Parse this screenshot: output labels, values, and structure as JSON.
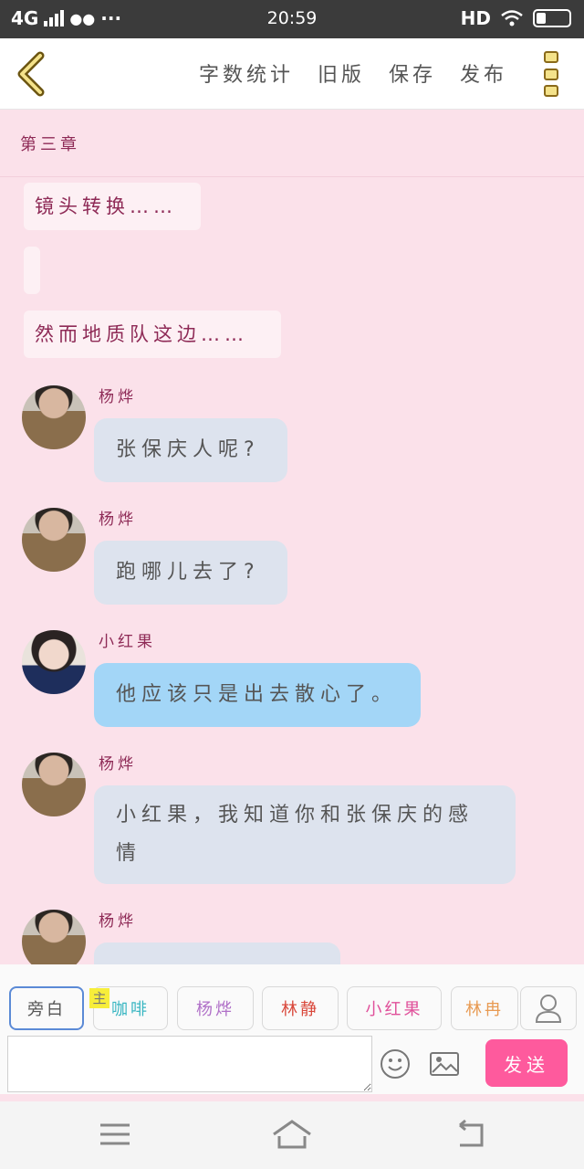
{
  "status_bar": {
    "network": "4G",
    "time": "20:59",
    "hd": "HD"
  },
  "toolbar": {
    "actions": [
      "字数统计",
      "旧版",
      "保存",
      "发布"
    ]
  },
  "chapter": {
    "title": "第三章"
  },
  "narration": [
    "镜头转换……",
    "",
    "然而地质队这边……"
  ],
  "messages": [
    {
      "name": "杨烨",
      "text": "张保庆人呢?",
      "style": "gray"
    },
    {
      "name": "杨烨",
      "text": "跑哪儿去了?",
      "style": "gray"
    },
    {
      "name": "小红果",
      "text": "他应该只是出去散心了。",
      "style": "blue"
    },
    {
      "name": "杨烨",
      "text_line1": "小红果，我知道你和张保庆的感",
      "text_line2": "情",
      "style": "gray"
    },
    {
      "name": "杨烨",
      "text": "",
      "style": "gray"
    }
  ],
  "characters": [
    {
      "label": "旁白",
      "color": "#555555"
    },
    {
      "label": "咖啡",
      "color": "#39b6c2"
    },
    {
      "label": "杨烨",
      "color": "#b070c8"
    },
    {
      "label": "林静",
      "color": "#d9473a"
    },
    {
      "label": "小红果",
      "color": "#e0509a"
    },
    {
      "label": "林冉",
      "color": "#e89a52"
    }
  ],
  "main_badge": "主",
  "input": {
    "placeholder": ""
  },
  "send_button": "发送",
  "icons": [
    "back-icon",
    "more-icon",
    "person-icon",
    "emoji-icon",
    "image-icon",
    "menu-nav-icon",
    "home-nav-icon",
    "return-nav-icon"
  ]
}
